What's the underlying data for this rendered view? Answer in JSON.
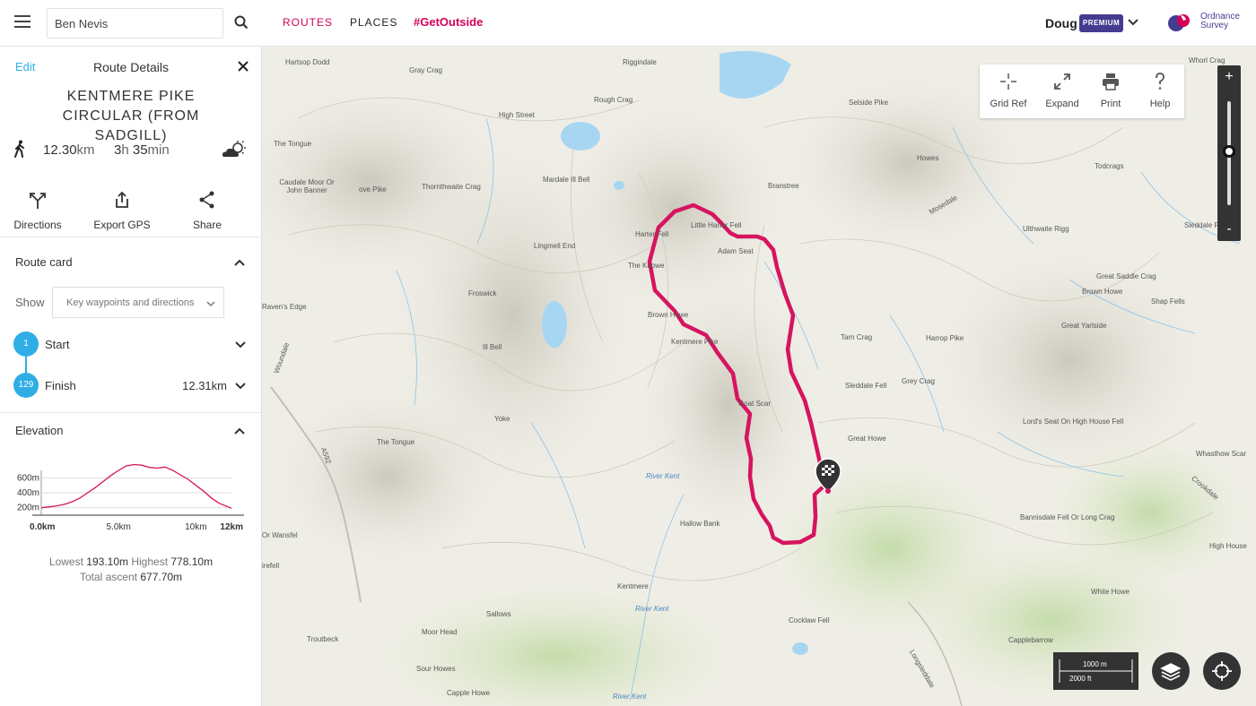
{
  "header": {
    "search_value": "Ben Nevis",
    "nav": {
      "routes": "ROUTES",
      "places": "PLACES",
      "get_outside": "#GetOutside"
    },
    "user": {
      "name": "Doug",
      "badge": "PREMIUM"
    },
    "logo": {
      "line1": "Ordnance",
      "line2": "Survey"
    }
  },
  "panel": {
    "edit": "Edit",
    "title": "Route Details",
    "route_name": "KENTMERE PIKE CIRCULAR (FROM SADGILL)",
    "distance_value": "12.30",
    "distance_unit": "km",
    "duration_hours": "3",
    "duration_h_unit": "h",
    "duration_minutes": "35",
    "duration_m_unit": "min",
    "weather_icon": "cloud-sun-icon",
    "actions": {
      "directions": "Directions",
      "export_gps": "Export GPS",
      "share": "Share"
    },
    "route_card": {
      "label": "Route card",
      "show_label": "Show",
      "show_value": "Key waypoints and directions",
      "waypoints": [
        {
          "num": "1",
          "name": "Start",
          "distance": ""
        },
        {
          "num": "129",
          "name": "Finish",
          "distance": "12.31km"
        }
      ]
    },
    "elevation": {
      "label": "Elevation",
      "y_ticks": [
        "600m",
        "400m",
        "200m"
      ],
      "x_ticks": [
        "0.0km",
        "5.0km",
        "10km",
        "12km"
      ],
      "lowest_label": "Lowest",
      "lowest": "193.10m",
      "highest_label": "Highest",
      "highest": "778.10m",
      "ascent_label": "Total ascent",
      "ascent": "677.70m"
    }
  },
  "chart_data": {
    "type": "area",
    "title": "Elevation",
    "x": [
      0,
      0.5,
      1,
      1.5,
      2,
      2.5,
      3,
      3.5,
      4,
      4.5,
      5,
      5.5,
      6,
      6.5,
      7,
      7.5,
      8,
      8.5,
      9,
      9.5,
      10,
      10.5,
      11,
      11.5,
      12.3
    ],
    "values": [
      200,
      210,
      225,
      245,
      280,
      330,
      400,
      470,
      550,
      630,
      700,
      760,
      778,
      770,
      740,
      730,
      745,
      700,
      640,
      580,
      500,
      420,
      330,
      260,
      193
    ],
    "xlabel": "",
    "ylabel": "",
    "xlim": [
      0,
      12.3
    ],
    "ylim": [
      100,
      700
    ],
    "grid": true
  },
  "map": {
    "labels": {
      "hartsop_dodd": "Hartsop Dodd",
      "gray_crag": "Gray Crag",
      "riggindale": "Riggindale",
      "rough_crag": "Rough Crag",
      "high_street": "High Street",
      "selside_pike": "Selside Pike",
      "the_tongue_n": "The Tongue",
      "caudale": "Caudale Moor Or John Banner",
      "stony_cove": "ove Pike",
      "thornthwaite": "Thornthwaite Crag",
      "mardale": "Mardale Ill Bell",
      "branstree": "Branstree",
      "howes": "Howes",
      "todcrags": "Todcrags",
      "harter_fell": "Harter Fell",
      "little_harter": "Little Harter Fell",
      "adam_seat": "Adam Seat",
      "lingmell_end": "Lingmell End",
      "the_knowe": "The Knowe",
      "froswick": "Froswick",
      "ravens_edge": "Raven's Edge",
      "ill_bell": "Ill Bell",
      "brown_howe": "Brown Howe",
      "kentmere_pike": "Kentmere Pike",
      "tarn_crag": "Tarn Crag",
      "harrop_pike": "Harrop Pike",
      "great_yarlside": "Great Yarlside",
      "brown_howe_e": "Brown Howe",
      "shap_fells": "Shap Fells",
      "great_saddle": "Great Saddle Crag",
      "ulthwaite": "Ulthwaite Rigg",
      "sleddale_pike": "Sleddale Pike",
      "sleddale_fell": "Sleddale Fell",
      "grey_crag": "Grey Crag",
      "goat_scar": "Goat Scar",
      "yoke": "Yoke",
      "the_tongue_s": "The Tongue",
      "great_howe": "Great Howe",
      "lords_seat": "Lord's Seat On High House Fell",
      "river_kent_1": "River Kent",
      "hallow_bank": "Hallow Bank",
      "bannisdale": "Bannisdale Fell Or Long Crag",
      "whasthow": "Whasthow Scar",
      "high_house": "High House",
      "or_wansfell": "Or Wansfel",
      "kentmere": "Kentmere",
      "river_kent_2": "River Kent",
      "white_howe": "White Howe",
      "cocklaw": "Cocklaw Fell",
      "capplebarrow": "Capplebarrow",
      "sallows": "Sallows",
      "moor_head": "Moor Head",
      "troutbeck": "Troutbeck",
      "sour_howes": "Sour Howes",
      "capple_howe": "Capple Howe",
      "river_kent_3": "River Kent",
      "whorl_crag": "Whorl Crag",
      "crookdale": "Crookdale",
      "longsleddale": "Longsleddale",
      "mosedale": "Mosedale",
      "woundale": "Woundale",
      "road": "A592",
      "irefell": "irefell"
    },
    "tools": {
      "grid_ref": "Grid Ref",
      "expand": "Expand",
      "print": "Print",
      "help": "Help"
    },
    "zoom": {
      "in": "+",
      "out": "-",
      "level": 0.52
    },
    "scale": {
      "metric": "1000 m",
      "imperial": "2000 ft"
    },
    "colors": {
      "route": "#d6145f",
      "accent": "#2eaee5",
      "brand": "#453c90"
    }
  }
}
